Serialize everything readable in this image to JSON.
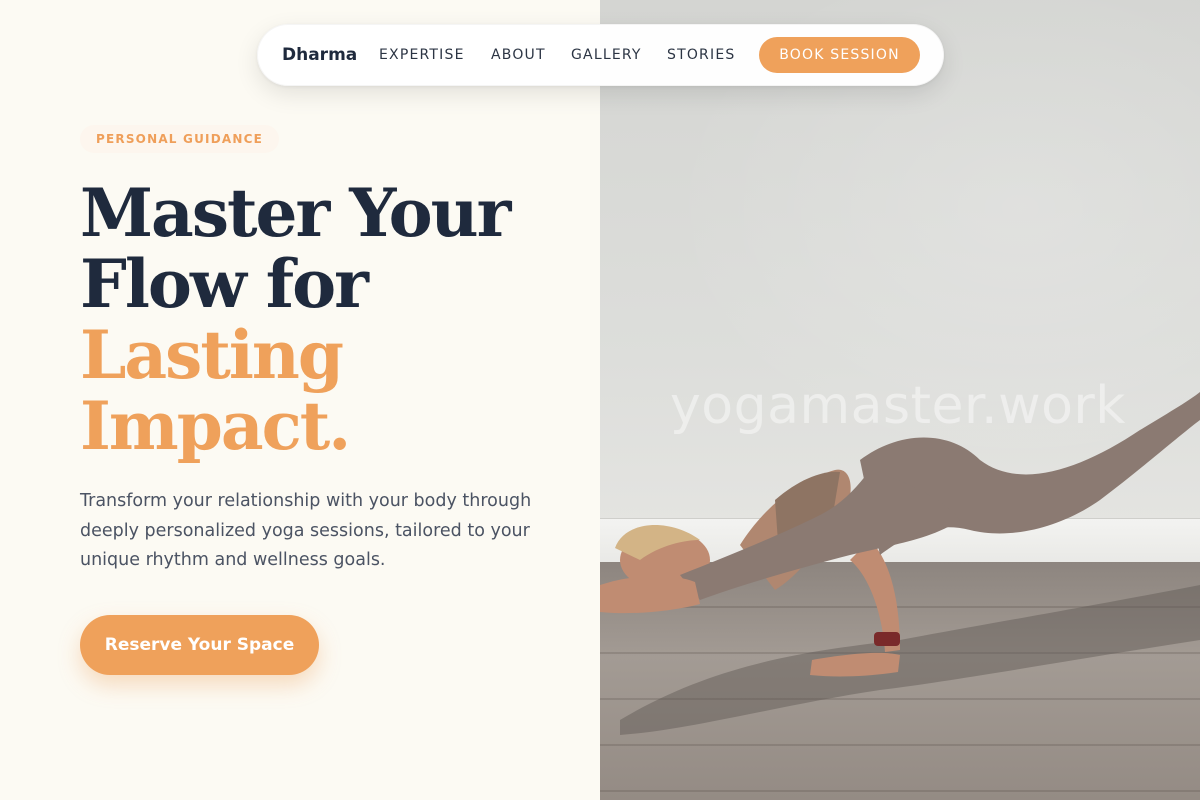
{
  "nav": {
    "brand": "Dharma",
    "links": [
      "EXPERTISE",
      "ABOUT",
      "GALLERY",
      "STORIES"
    ],
    "cta": "BOOK SESSION"
  },
  "hero": {
    "eyebrow": "PERSONAL GUIDANCE",
    "headline_dark": [
      "Master Your",
      "Flow for"
    ],
    "headline_accent": [
      "Lasting",
      "Impact."
    ],
    "subtext": "Transform your relationship with your body through deeply personalized yoga sessions, tailored to your unique rhythm and wellness goals.",
    "cta": "Reserve Your Space"
  },
  "image": {
    "watermark": "yogamaster.work",
    "subject": "yoga-practitioner-arm-balance"
  },
  "colors": {
    "accent": "#efa15b",
    "heading": "#1f2a3d",
    "body_text": "#4b5363",
    "background": "#fcfaf3"
  }
}
